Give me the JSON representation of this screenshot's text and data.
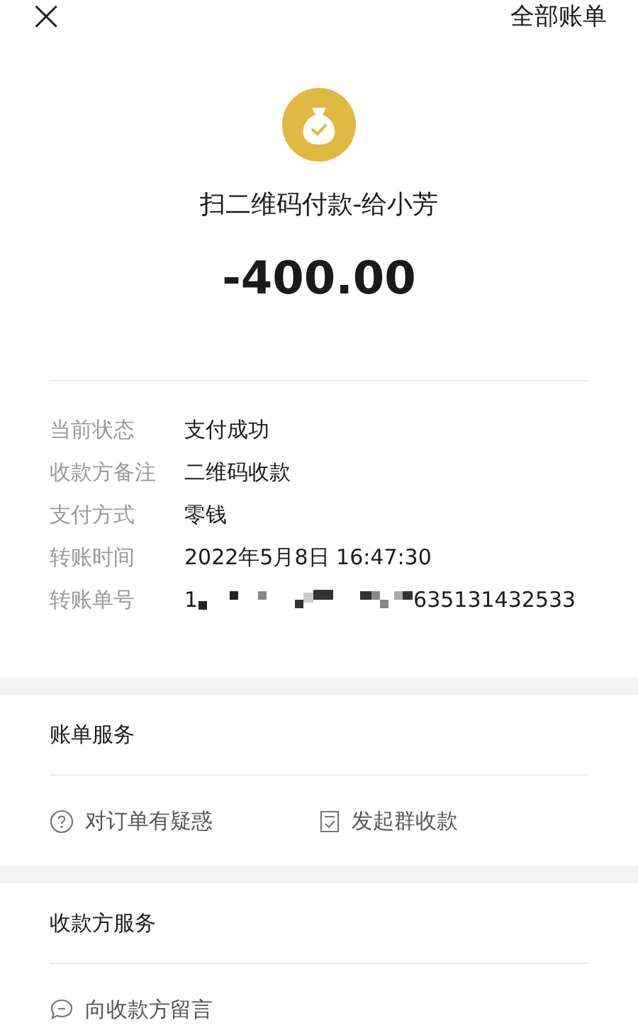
{
  "top_bar": {
    "close": "×",
    "all_bills": "全部账单"
  },
  "payment": {
    "title": "扫二维码付款-给小芳",
    "amount": "-400.00"
  },
  "details": [
    {
      "kind": "text",
      "label": "当前状态",
      "value": "支付成功"
    },
    {
      "kind": "text",
      "label": "收款方备注",
      "value": "二维码收款"
    },
    {
      "kind": "text",
      "label": "支付方式",
      "value": "零钱"
    },
    {
      "kind": "text",
      "label": "转账时间",
      "value": "2022年5月8日 16:47:30"
    },
    {
      "kind": "redacted",
      "label": "转账单号",
      "value_start": "1",
      "value_end": "635131432533"
    }
  ],
  "sections": [
    {
      "title": "账单服务",
      "actions": [
        {
          "kind": "question",
          "label": "对订单有疑惑"
        },
        {
          "kind": "checklist",
          "label": "发起群收款"
        }
      ]
    },
    {
      "title": "收款方服务",
      "actions": [
        {
          "kind": "message",
          "label": "向收款方留言"
        }
      ]
    }
  ]
}
